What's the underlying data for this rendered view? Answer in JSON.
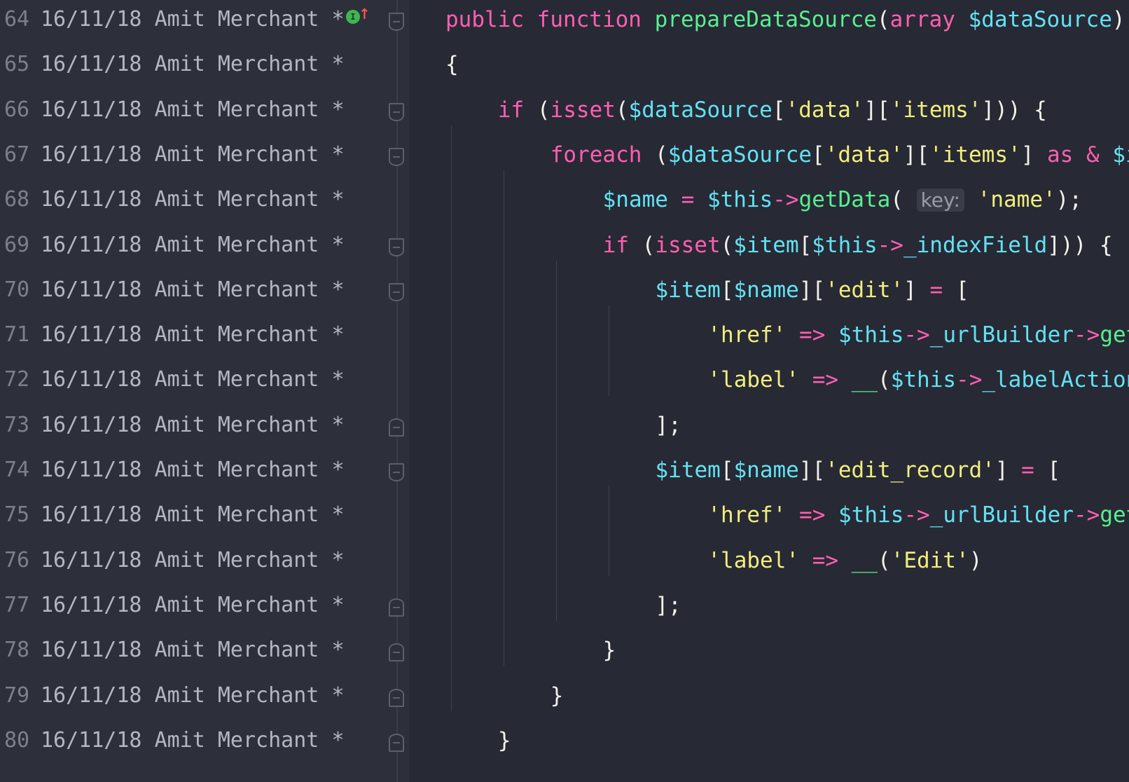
{
  "gutter": {
    "rows": [
      {
        "line": "64",
        "date": "16/11/18",
        "author": "Amit Merchant",
        "mark": "*"
      },
      {
        "line": "65",
        "date": "16/11/18",
        "author": "Amit Merchant",
        "mark": "*"
      },
      {
        "line": "66",
        "date": "16/11/18",
        "author": "Amit Merchant",
        "mark": "*"
      },
      {
        "line": "67",
        "date": "16/11/18",
        "author": "Amit Merchant",
        "mark": "*"
      },
      {
        "line": "68",
        "date": "16/11/18",
        "author": "Amit Merchant",
        "mark": "*"
      },
      {
        "line": "69",
        "date": "16/11/18",
        "author": "Amit Merchant",
        "mark": "*"
      },
      {
        "line": "70",
        "date": "16/11/18",
        "author": "Amit Merchant",
        "mark": "*"
      },
      {
        "line": "71",
        "date": "16/11/18",
        "author": "Amit Merchant",
        "mark": "*"
      },
      {
        "line": "72",
        "date": "16/11/18",
        "author": "Amit Merchant",
        "mark": "*"
      },
      {
        "line": "73",
        "date": "16/11/18",
        "author": "Amit Merchant",
        "mark": "*"
      },
      {
        "line": "74",
        "date": "16/11/18",
        "author": "Amit Merchant",
        "mark": "*"
      },
      {
        "line": "75",
        "date": "16/11/18",
        "author": "Amit Merchant",
        "mark": "*"
      },
      {
        "line": "76",
        "date": "16/11/18",
        "author": "Amit Merchant",
        "mark": "*"
      },
      {
        "line": "77",
        "date": "16/11/18",
        "author": "Amit Merchant",
        "mark": "*"
      },
      {
        "line": "78",
        "date": "16/11/18",
        "author": "Amit Merchant",
        "mark": "*"
      },
      {
        "line": "79",
        "date": "16/11/18",
        "author": "Amit Merchant",
        "mark": "*"
      },
      {
        "line": "80",
        "date": "16/11/18",
        "author": "Amit Merchant",
        "mark": "*"
      }
    ],
    "change_marker_icon": "implements-up-arrow-icon",
    "fold_icons": {
      "0": "fold-open-icon",
      "2": "fold-open-icon",
      "3": "fold-open-icon",
      "5": "fold-open-icon",
      "6": "fold-open-icon",
      "9": "fold-close-icon",
      "10": "fold-open-icon",
      "13": "fold-close-icon",
      "14": "fold-close-icon",
      "15": "fold-close-icon",
      "16": "fold-close-icon"
    }
  },
  "code": {
    "lines": [
      [
        [
          "kw",
          "public "
        ],
        [
          "kw",
          "function "
        ],
        [
          "fn",
          "prepareDataSource"
        ],
        [
          "plain",
          "("
        ],
        [
          "kw",
          "array "
        ],
        [
          "var",
          "$dataSource"
        ],
        [
          "plain",
          ")"
        ]
      ],
      [
        [
          "plain",
          "{"
        ]
      ],
      [
        [
          "kw",
          "if "
        ],
        [
          "plain",
          "("
        ],
        [
          "kw",
          "isset"
        ],
        [
          "plain",
          "("
        ],
        [
          "var",
          "$dataSource"
        ],
        [
          "plain",
          "["
        ],
        [
          "str",
          "'data'"
        ],
        [
          "plain",
          "]["
        ],
        [
          "str",
          "'items'"
        ],
        [
          "plain",
          "])) {"
        ]
      ],
      [
        [
          "kw",
          "foreach "
        ],
        [
          "plain",
          "("
        ],
        [
          "var",
          "$dataSource"
        ],
        [
          "plain",
          "["
        ],
        [
          "str",
          "'data'"
        ],
        [
          "plain",
          "]["
        ],
        [
          "str",
          "'items'"
        ],
        [
          "plain",
          "] "
        ],
        [
          "kw",
          "as "
        ],
        [
          "op",
          "& "
        ],
        [
          "var",
          "$item"
        ]
      ],
      [
        [
          "var",
          "$name "
        ],
        [
          "op",
          "= "
        ],
        [
          "var",
          "$this"
        ],
        [
          "op",
          "->"
        ],
        [
          "fn",
          "getData"
        ],
        [
          "plain",
          "( "
        ],
        [
          "hint",
          "key:"
        ],
        [
          "plain",
          " "
        ],
        [
          "str",
          "'name'"
        ],
        [
          "plain",
          ");"
        ]
      ],
      [
        [
          "kw",
          "if "
        ],
        [
          "plain",
          "("
        ],
        [
          "kw",
          "isset"
        ],
        [
          "plain",
          "("
        ],
        [
          "var",
          "$item"
        ],
        [
          "plain",
          "["
        ],
        [
          "var",
          "$this"
        ],
        [
          "op",
          "->"
        ],
        [
          "var",
          "_indexField"
        ],
        [
          "plain",
          "])) {"
        ]
      ],
      [
        [
          "var",
          "$item"
        ],
        [
          "plain",
          "["
        ],
        [
          "var",
          "$name"
        ],
        [
          "plain",
          "]["
        ],
        [
          "str",
          "'edit'"
        ],
        [
          "plain",
          "] "
        ],
        [
          "op",
          "= "
        ],
        [
          "plain",
          "["
        ]
      ],
      [
        [
          "str",
          "'href' "
        ],
        [
          "op",
          "=> "
        ],
        [
          "var",
          "$this"
        ],
        [
          "op",
          "->"
        ],
        [
          "var",
          "_urlBuilder"
        ],
        [
          "op",
          "->"
        ],
        [
          "fn",
          "getUrl"
        ]
      ],
      [
        [
          "str",
          "'label' "
        ],
        [
          "op",
          "=> "
        ],
        [
          "fn",
          "__"
        ],
        [
          "plain",
          "("
        ],
        [
          "var",
          "$this"
        ],
        [
          "op",
          "->"
        ],
        [
          "var",
          "_labelAction"
        ]
      ],
      [
        [
          "plain",
          "];"
        ]
      ],
      [
        [
          "var",
          "$item"
        ],
        [
          "plain",
          "["
        ],
        [
          "var",
          "$name"
        ],
        [
          "plain",
          "]["
        ],
        [
          "str",
          "'edit_record'"
        ],
        [
          "plain",
          "] "
        ],
        [
          "op",
          "= "
        ],
        [
          "plain",
          "["
        ]
      ],
      [
        [
          "str",
          "'href' "
        ],
        [
          "op",
          "=> "
        ],
        [
          "var",
          "$this"
        ],
        [
          "op",
          "->"
        ],
        [
          "var",
          "_urlBuilder"
        ],
        [
          "op",
          "->"
        ],
        [
          "fn",
          "getUrl"
        ]
      ],
      [
        [
          "str",
          "'label' "
        ],
        [
          "op",
          "=> "
        ],
        [
          "fn",
          "__"
        ],
        [
          "plain",
          "("
        ],
        [
          "str",
          "'Edit'"
        ],
        [
          "plain",
          ")"
        ]
      ],
      [
        [
          "plain",
          "];"
        ]
      ],
      [
        [
          "plain",
          "}"
        ]
      ],
      [
        [
          "plain",
          "}"
        ]
      ],
      [
        [
          "plain",
          "}"
        ]
      ]
    ]
  },
  "colors": {
    "background": "#272935",
    "gutter_background": "#2d2f3b",
    "keyword": "#ff5fb0",
    "function": "#58f08f",
    "variable": "#62e2f2",
    "string": "#f2ee7c",
    "text": "#f2f2ea",
    "annotation_text": "#b4b6c2",
    "line_number": "#7d7f8c"
  }
}
